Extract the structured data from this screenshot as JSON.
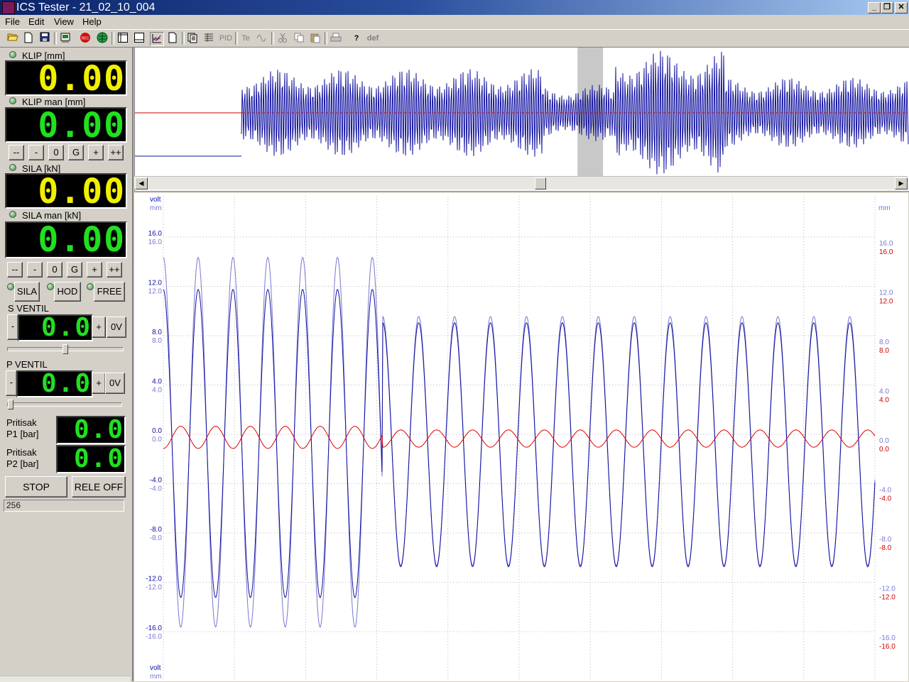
{
  "window": {
    "title": "ICS Tester - 21_02_10_004"
  },
  "title_buttons": {
    "minimize": "_",
    "restore": "❐",
    "close": "✕"
  },
  "menu": [
    "File",
    "Edit",
    "View",
    "Help"
  ],
  "toolbar": {
    "icons": [
      "open-folder-icon",
      "new-file-icon",
      "save-icon",
      "print-preview-icon",
      "record-icon",
      "globe-icon",
      "layout-panel-icon",
      "layout-split-icon",
      "chart-icon",
      "page-icon",
      "report-icon",
      "grid-icon",
      "pid-icon",
      "te-icon",
      "wave-icon",
      "cut-icon",
      "copy-icon",
      "paste-icon",
      "print-icon",
      "help-icon",
      "def-icon"
    ],
    "pid_label": "PID",
    "te_label": "Te",
    "def_label": "def",
    "help_label": "?"
  },
  "panel": {
    "klip": {
      "label": "KLIP [mm]",
      "value": "0.00"
    },
    "klip_man": {
      "label": "KLIP  man [mm]",
      "value": "0.00"
    },
    "klip_buttons": [
      "--",
      "-",
      "0",
      "G",
      "+",
      "++"
    ],
    "sila": {
      "label": "SILA [kN]",
      "value": "0.00"
    },
    "sila_man": {
      "label": "SILA man [kN]",
      "value": "0.00"
    },
    "sila_buttons": [
      "--",
      "-",
      "0",
      "G",
      "+",
      "++"
    ],
    "modes": [
      "SILA",
      "HOD",
      "FREE"
    ],
    "s_ventil": {
      "label": "S VENTIL",
      "value": "0.0",
      "minus": "-",
      "plus": "+",
      "zero": "0V",
      "slider_fraction": 0.5
    },
    "p_ventil": {
      "label": "P VENTIL",
      "value": "0.0",
      "minus": "-",
      "plus": "+",
      "zero": "0V",
      "slider_fraction": 0.0
    },
    "p1": {
      "label_1": "Pritisak",
      "label_2": "P1 [bar]",
      "value": "0.0"
    },
    "p2": {
      "label_1": "Pritisak",
      "label_2": "P2 [bar]",
      "value": "0.0"
    },
    "stop_label": "STOP",
    "rele_label": "RELE OFF",
    "status_value": "256"
  },
  "chart_data": {
    "type": "line",
    "left_axis_units": [
      "volt",
      "mm"
    ],
    "right_axis_units": [
      "mm"
    ],
    "bottom_axis_units": [
      "volt",
      "mm"
    ],
    "left_ticks_a": [
      "16.0",
      "12.0",
      "8.0",
      "4.0",
      "0.0",
      "-4.0",
      "-8.0",
      "-12.0",
      "-16.0"
    ],
    "left_ticks_b": [
      "16.0",
      "12.0",
      "8.0",
      "4.0",
      "0.0",
      "-4.0",
      "-8.0",
      "-12.0",
      "-16.0"
    ],
    "right_ticks_a": [
      "16.0",
      "12.0",
      "8.0",
      "4.0",
      "0.0",
      "-4.0",
      "-8.0",
      "-12.0",
      "-16.0"
    ],
    "right_ticks_b": [
      "16.0",
      "12.0",
      "8.0",
      "4.0",
      "0.0",
      "-4.0",
      "-8.0",
      "-12.0",
      "-16.0"
    ],
    "ylim": [
      -16,
      16
    ],
    "grid": true,
    "series": [
      {
        "color": "#7878d0",
        "segments": [
          {
            "cycles": 6.3,
            "amplitude": 15.0,
            "offset": -0.3
          },
          {
            "cycles": 13.7,
            "amplitude": 10.1,
            "offset": -0.2
          }
        ]
      },
      {
        "color": "#1010a0",
        "segments": [
          {
            "cycles": 6.3,
            "amplitude": 12.5,
            "offset": -0.4
          },
          {
            "cycles": 13.7,
            "amplitude": 9.9,
            "offset": -0.5
          }
        ]
      },
      {
        "color": "#e00000",
        "segments": [
          {
            "cycles": 6.3,
            "amplitude": 0.9,
            "offset": 0.1
          },
          {
            "cycles": 13.7,
            "amplitude": 0.7,
            "offset": 0.0
          }
        ]
      }
    ]
  },
  "overview": {
    "highlight_fraction": 0.535,
    "scroll_fraction": 0.52,
    "left_arrow": "◀",
    "right_arrow": "▶"
  }
}
